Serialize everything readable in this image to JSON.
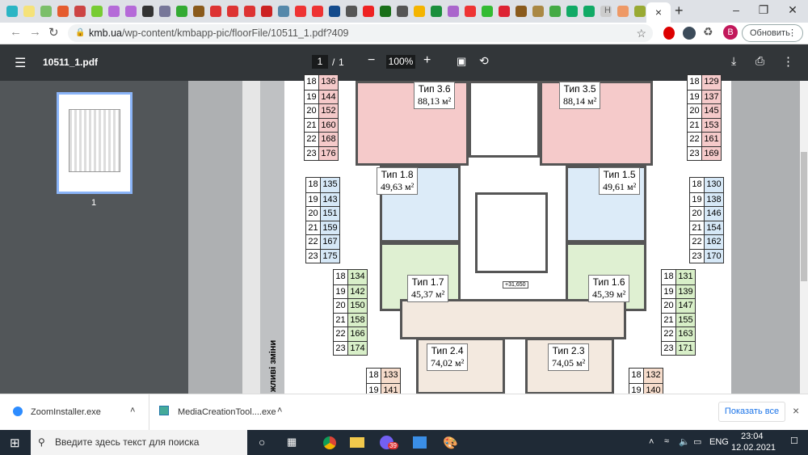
{
  "browser": {
    "url_host": "kmb.ua",
    "url_path": "/wp-content/kmbapp-pic/floorFile/10511_1.pdf?409",
    "update_label": "Обновить",
    "profile_initial": "B",
    "new_tab": "+",
    "close_tab": "×",
    "tab_letter": "H"
  },
  "pdf": {
    "title": "10511_1.pdf",
    "page_current": "1",
    "page_sep": "/",
    "page_total": "1",
    "zoom": "100%",
    "thumb_label": "1"
  },
  "plan": {
    "side_note": "жливі зміни",
    "level_mark": "+31,650",
    "apartments": [
      {
        "type": "Тип 3.6",
        "area": "88,13 м²"
      },
      {
        "type": "Тип 3.5",
        "area": "88,14 м²"
      },
      {
        "type": "Тип 1.8",
        "area": "49,63 м²"
      },
      {
        "type": "Тип 1.5",
        "area": "49,61 м²"
      },
      {
        "type": "Тип 1.7",
        "area": "45,37 м²"
      },
      {
        "type": "Тип 1.6",
        "area": "45,39 м²"
      },
      {
        "type": "Тип 2.4",
        "area": "74,02 м²"
      },
      {
        "type": "Тип 2.3",
        "area": "74,05 м²"
      }
    ],
    "tables": [
      {
        "color": "#f5caca",
        "rows": [
          [
            "18",
            "136"
          ],
          [
            "19",
            "144"
          ],
          [
            "20",
            "152"
          ],
          [
            "21",
            "160"
          ],
          [
            "22",
            "168"
          ],
          [
            "23",
            "176"
          ]
        ]
      },
      {
        "color": "#f5caca",
        "rows": [
          [
            "18",
            "129"
          ],
          [
            "19",
            "137"
          ],
          [
            "20",
            "145"
          ],
          [
            "21",
            "153"
          ],
          [
            "22",
            "161"
          ],
          [
            "23",
            "169"
          ]
        ]
      },
      {
        "color": "#d6e8f7",
        "rows": [
          [
            "18",
            "135"
          ],
          [
            "19",
            "143"
          ],
          [
            "20",
            "151"
          ],
          [
            "21",
            "159"
          ],
          [
            "22",
            "167"
          ],
          [
            "23",
            "175"
          ]
        ]
      },
      {
        "color": "#d6e8f7",
        "rows": [
          [
            "18",
            "130"
          ],
          [
            "19",
            "138"
          ],
          [
            "20",
            "146"
          ],
          [
            "21",
            "154"
          ],
          [
            "22",
            "162"
          ],
          [
            "23",
            "170"
          ]
        ]
      },
      {
        "color": "#d8efc8",
        "rows": [
          [
            "18",
            "134"
          ],
          [
            "19",
            "142"
          ],
          [
            "20",
            "150"
          ],
          [
            "21",
            "158"
          ],
          [
            "22",
            "166"
          ],
          [
            "23",
            "174"
          ]
        ]
      },
      {
        "color": "#d8efc8",
        "rows": [
          [
            "18",
            "131"
          ],
          [
            "19",
            "139"
          ],
          [
            "20",
            "147"
          ],
          [
            "21",
            "155"
          ],
          [
            "22",
            "163"
          ],
          [
            "23",
            "171"
          ]
        ]
      },
      {
        "color": "#f6dccb",
        "rows": [
          [
            "18",
            "133"
          ],
          [
            "19",
            "141"
          ]
        ]
      },
      {
        "color": "#f6dccb",
        "rows": [
          [
            "18",
            "132"
          ],
          [
            "19",
            "140"
          ]
        ]
      }
    ]
  },
  "downloads": {
    "items": [
      {
        "name": "ZoomInstaller.exe"
      },
      {
        "name": "MediaCreationTool....exe"
      }
    ],
    "show_all": "Показать все",
    "close": "×"
  },
  "taskbar": {
    "search_placeholder": "Введите здесь текст для поиска",
    "lang": "ENG",
    "time": "23:04",
    "date": "12.02.2021",
    "badge": "39"
  }
}
